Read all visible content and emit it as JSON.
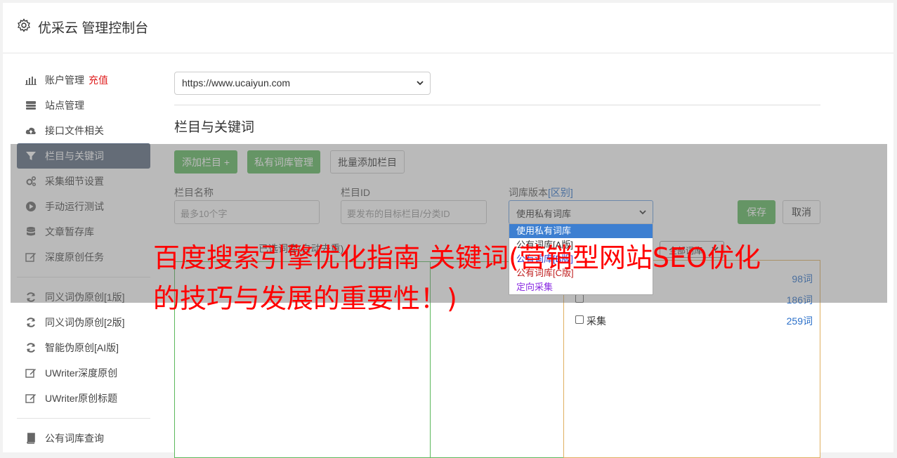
{
  "header": {
    "title": "优采云 管理控制台"
  },
  "sidebar": {
    "items": [
      {
        "label": "账户管理",
        "badge": "充值",
        "icon": "bar-chart-icon"
      },
      {
        "label": "站点管理",
        "icon": "server-icon"
      },
      {
        "label": "接口文件相关",
        "icon": "cloud-upload-icon"
      },
      {
        "label": "栏目与关键词",
        "icon": "filter-icon",
        "active": true
      },
      {
        "label": "采集细节设置",
        "icon": "cogs-icon"
      },
      {
        "label": "手动运行测试",
        "icon": "play-circle-icon"
      },
      {
        "label": "文章暂存库",
        "icon": "database-icon"
      },
      {
        "label": "深度原创任务",
        "icon": "edit-icon"
      }
    ],
    "items2": [
      {
        "label": "同义词伪原创[1版]",
        "icon": "refresh-icon"
      },
      {
        "label": "同义词伪原创[2版]",
        "icon": "refresh-icon"
      },
      {
        "label": "智能伪原创[AI版]",
        "icon": "refresh-icon"
      },
      {
        "label": "UWriter深度原创",
        "icon": "edit-icon"
      },
      {
        "label": "UWriter原创标题",
        "icon": "edit-icon"
      }
    ],
    "items3": [
      {
        "label": "公有词库查询",
        "icon": "book-icon"
      }
    ]
  },
  "main": {
    "site_select_value": "https://www.ucaiyun.com",
    "section_title": "栏目与关键词",
    "buttons": {
      "add_column": "添加栏目 +",
      "private_lexicon": "私有词库管理",
      "batch_add": "批量添加栏目",
      "save": "保存",
      "cancel": "取消"
    },
    "form": {
      "column_name_label": "栏目名称",
      "column_name_placeholder": "最多10个字",
      "column_id_label": "栏目ID",
      "column_id_placeholder": "要发布的目标栏目/分类ID",
      "lexicon_version_label": "词库版本",
      "lexicon_version_diff": "[区别]",
      "lexicon_version_value": "使用私有词库"
    },
    "dropdown_options": [
      "使用私有词库",
      "公有词库[A版]",
      "公有词库[B版]",
      "公有词库[C版]",
      "定向采集"
    ],
    "selected_words_label": "已选词库(自动去重)",
    "filter_value": "全部词库",
    "word_rows": [
      {
        "name": "",
        "count": "98词"
      },
      {
        "name": "",
        "count": "186词"
      },
      {
        "name": "采集",
        "count": "259词"
      }
    ]
  },
  "promo_text": "百度搜索引擎优化指南 关键词(营销型网站SEO优化的技巧与发展的重要性！)",
  "colors": {
    "green": "#5cb85c",
    "active_sidebar": "#5b6a7f",
    "promo_red": "#ff0000"
  }
}
